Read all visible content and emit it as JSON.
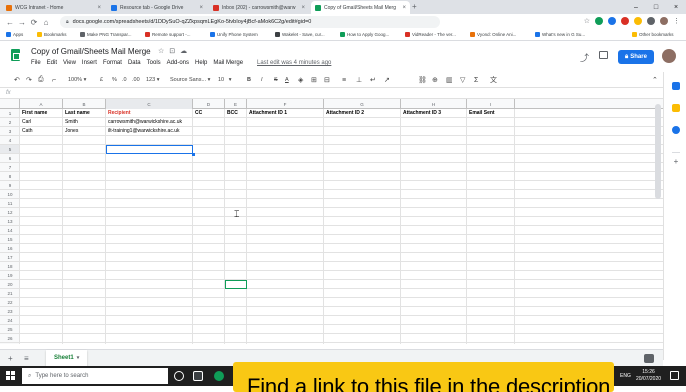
{
  "browser": {
    "tabs": [
      {
        "title": "WCG Intranet - Home",
        "icon_color": "#e8710a"
      },
      {
        "title": "Resource tab - Google Drive",
        "icon_color": "#1a73e8"
      },
      {
        "title": "Inbox (202) - carrowsmith@warw",
        "icon_color": "#d93025"
      },
      {
        "title": "Copy of Gmail/Sheets Mail Merg",
        "icon_color": "#0f9d58",
        "active": true
      }
    ],
    "new_tab": "+",
    "url": "docs.google.com/spreadsheets/d/1DDySuO-qZZkpsqmLEgKo-5tvbIoy4jBcf-aMok6C2g/edit#gid=0",
    "bookmarks": [
      "Apps",
      "Bookmarks",
      "Make PNG Transpar...",
      "Remote support -...",
      "Unify Phone System",
      "Wakelet - Save, cur...",
      "How to Apply Goog...",
      "VidReader - The ver...",
      "Vyond: Online Ani...",
      "What's new in G Su...",
      "Other bookmarks"
    ]
  },
  "sheets": {
    "doc_title": "Copy of Gmail/Sheets Mail Merge",
    "menu": [
      "File",
      "Edit",
      "View",
      "Insert",
      "Format",
      "Data",
      "Tools",
      "Add-ons",
      "Help",
      "Mail Merge"
    ],
    "last_edit": "Last edit was 4 minutes ago",
    "share_label": "Share",
    "toolbar": {
      "zoom": "100%",
      "currency": "£",
      "percent": "%",
      "dec_less": ".0",
      "dec_more": ".00",
      "more_formats": "123",
      "font": "Source Sans...",
      "font_size": "10",
      "bold": "B",
      "italic": "I",
      "strike": "S",
      "text_color": "A"
    },
    "fx": "fx",
    "columns": [
      "A",
      "B",
      "C",
      "D",
      "E",
      "F",
      "G",
      "H",
      "I"
    ],
    "rows": [
      "1",
      "2",
      "3",
      "4",
      "5",
      "6",
      "7",
      "8",
      "9",
      "10",
      "11",
      "12",
      "13",
      "14",
      "15",
      "16",
      "17",
      "18",
      "19",
      "20",
      "21",
      "22",
      "23",
      "24",
      "25",
      "26"
    ],
    "headers": [
      "First name",
      "Last name",
      "Recipient",
      "CC",
      "BCC",
      "Attachment ID 1",
      "Attachment ID 2",
      "Attachment ID 3",
      "Email Sent"
    ],
    "data_rows": [
      [
        "Carl",
        "Smith",
        "carrowsmith@warwickshire.ac.uk",
        "",
        "",
        "",
        "",
        "",
        ""
      ],
      [
        "Cath",
        "Jones",
        "ilt-training1@warwickshire.ac.uk",
        "",
        "",
        "",
        "",
        "",
        ""
      ]
    ],
    "sheet_tab": "Sheet1"
  },
  "taskbar": {
    "search_placeholder": "Type here to search",
    "lang": "ENG",
    "time": "15:26",
    "date": "20/07/2020"
  },
  "banner": {
    "text": "Find a link to this file in the description"
  }
}
